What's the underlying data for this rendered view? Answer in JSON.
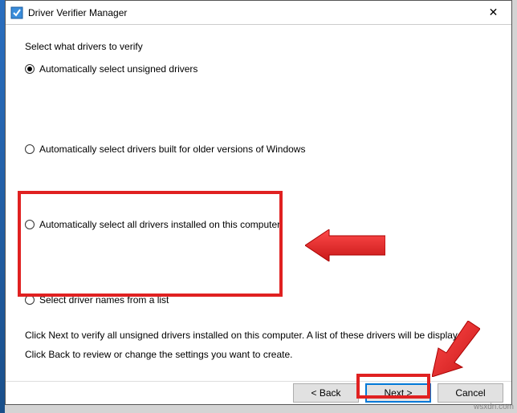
{
  "window": {
    "title": "Driver Verifier Manager",
    "close_label": "✕"
  },
  "content": {
    "heading": "Select what drivers to verify",
    "options": {
      "opt1": "Automatically select unsigned drivers",
      "opt2": "Automatically select drivers built for older versions of Windows",
      "opt3": "Automatically select all drivers installed on this computer",
      "opt4": "Select driver names from a list"
    },
    "help1": "Click Next to verify all unsigned drivers installed on this computer. A list of these drivers will be displayed.",
    "help2": "Click Back to review or change the settings you want to create."
  },
  "buttons": {
    "back": "< Back",
    "next": "Next >",
    "cancel": "Cancel"
  },
  "watermark": "wsxdn.com"
}
